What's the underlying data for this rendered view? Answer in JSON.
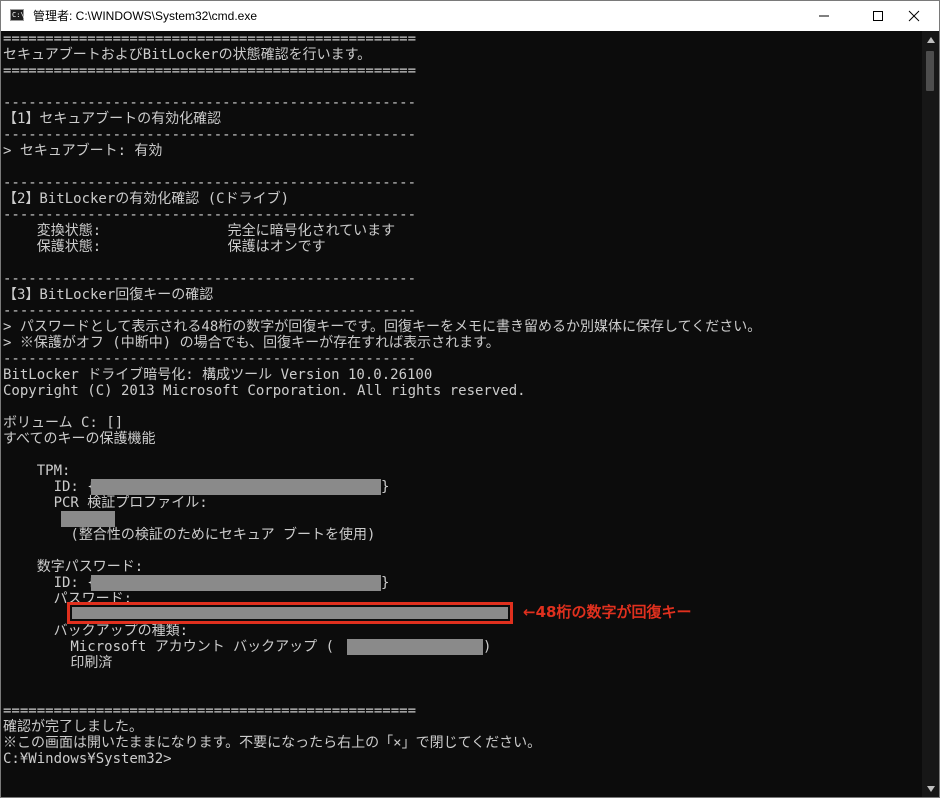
{
  "window": {
    "title": "管理者: C:\\WINDOWS\\System32\\cmd.exe",
    "icon": "cmd-icon",
    "icon_text": "C:\\",
    "controls": [
      "minimize-icon",
      "maximize-icon",
      "close-icon"
    ]
  },
  "console": {
    "lines": [
      "=================================================",
      "セキュアブートおよびBitLockerの状態確認を行います。",
      "=================================================",
      "",
      "-------------------------------------------------",
      "【1】セキュアブートの有効化確認",
      "-------------------------------------------------",
      "> セキュアブート: 有効",
      "",
      "-------------------------------------------------",
      "【2】BitLockerの有効化確認 (Cドライブ)",
      "-------------------------------------------------",
      "    変換状態:               完全に暗号化されています",
      "    保護状態:               保護はオンです",
      "",
      "-------------------------------------------------",
      "【3】BitLocker回復キーの確認",
      "-------------------------------------------------",
      "> パスワードとして表示される48桁の数字が回復キーです。回復キーをメモに書き留めるか別媒体に保存してください。",
      "> ※保護がオフ (中断中) の場合でも、回復キーが存在すれば表示されます。",
      "-------------------------------------------------",
      "BitLocker ドライブ暗号化: 構成ツール Version 10.0.26100",
      "Copyright (C) 2013 Microsoft Corporation. All rights reserved.",
      "",
      "ボリューム C: []",
      "すべてのキーの保護機能",
      "",
      "    TPM:",
      "      ID: {",
      "      PCR 検証プロファイル:",
      "",
      "        (整合性の検証のためにセキュア ブートを使用)",
      "",
      "    数字パスワード:",
      "      ID: {",
      "      パスワード:",
      "",
      "      バックアップの種類:",
      "        Microsoft アカウント バックアップ (",
      "        印刷済",
      "",
      "",
      "=================================================",
      "確認が完了しました。",
      "※この画面は開いたままになります。不要になったら右上の「×」で閉じてください。",
      "C:¥Windows¥System32>"
    ]
  },
  "annotation": {
    "text": "←48桁の数字が回復キー",
    "color": "#e0301e"
  },
  "colors": {
    "console_background": "#0c0c0c",
    "console_text": "#cccccc",
    "redaction": "#8a8a8a",
    "highlight": "#e0301e"
  }
}
